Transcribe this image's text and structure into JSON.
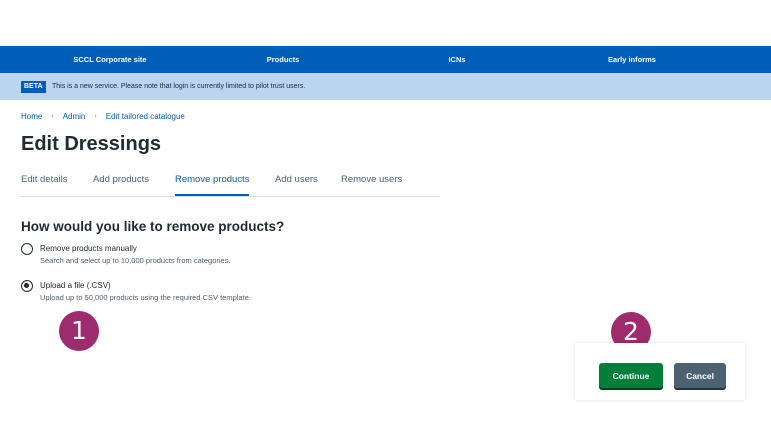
{
  "nav": {
    "items": [
      {
        "label": "SCCL Corporate site"
      },
      {
        "label": "Products"
      },
      {
        "label": "ICNs"
      },
      {
        "label": "Early informs"
      }
    ]
  },
  "beta": {
    "tag": "BETA",
    "text": "This is a new service. Please note that login is currently limited to pilot trust users."
  },
  "breadcrumb": {
    "items": [
      {
        "label": "Home"
      },
      {
        "label": "Admin"
      },
      {
        "label": "Edit tailored catalogue"
      }
    ],
    "separator": "›"
  },
  "page": {
    "title": "Edit Dressings"
  },
  "tabs": [
    {
      "label": "Edit details",
      "active": false
    },
    {
      "label": "Add products",
      "active": false
    },
    {
      "label": "Remove products",
      "active": true
    },
    {
      "label": "Add users",
      "active": false
    },
    {
      "label": "Remove users",
      "active": false
    }
  ],
  "form": {
    "legend": "How would you like to remove products?",
    "options": [
      {
        "label": "Remove products manually",
        "hint": "Search and select up to 10,000 products from categories.",
        "checked": false
      },
      {
        "label": "Upload a file (.CSV)",
        "hint": "Upload up to 50,000 products using the required CSV template.",
        "checked": true
      }
    ]
  },
  "markers": [
    {
      "label": "1"
    },
    {
      "label": "2"
    }
  ],
  "actions": {
    "continue_label": "Continue",
    "cancel_label": "Cancel"
  },
  "colors": {
    "nav_bg": "#005eb8",
    "banner_bg": "#bbd4ef",
    "continue_bg": "#007f3b",
    "cancel_bg": "#4c6272",
    "marker_bg": "#9e2b6e"
  }
}
